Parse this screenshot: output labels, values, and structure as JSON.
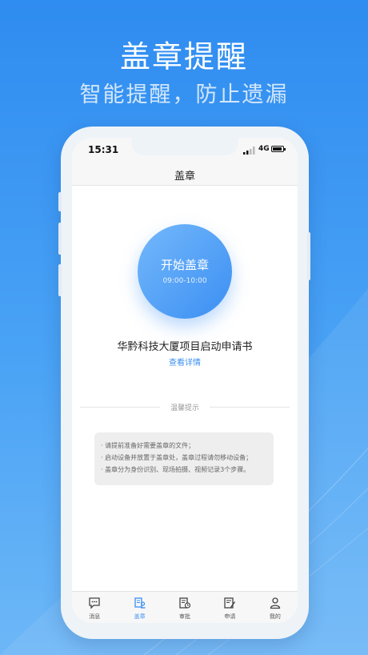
{
  "promo": {
    "title": "盖章提醒",
    "subtitle": "智能提醒，防止遗漏"
  },
  "status_bar": {
    "time": "15:31",
    "network": "4G"
  },
  "nav": {
    "title": "盖章"
  },
  "stamp": {
    "label": "开始盖章",
    "hours": "09:00-10:00"
  },
  "document": {
    "title": "华黔科技大厦项目启动申请书",
    "details_link": "查看详情"
  },
  "tips": {
    "title": "温馨提示",
    "lines": [
      "· 请提前准备好需要盖章的文件；",
      "· 启动设备并放置于盖章处，盖章过程请勿移动设备；",
      "· 盖章分为身份识别、现场拍摄、视频记录3个步骤。"
    ]
  },
  "tabs": [
    {
      "label": "消息",
      "icon": "message-icon",
      "active": false
    },
    {
      "label": "盖章",
      "icon": "stamp-icon",
      "active": true
    },
    {
      "label": "审批",
      "icon": "approval-icon",
      "active": false
    },
    {
      "label": "申请",
      "icon": "apply-icon",
      "active": false
    },
    {
      "label": "我的",
      "icon": "profile-icon",
      "active": false
    }
  ],
  "colors": {
    "accent": "#3b8ff3",
    "background_top": "#2f8cf0",
    "background_bottom": "#6db7f7"
  }
}
